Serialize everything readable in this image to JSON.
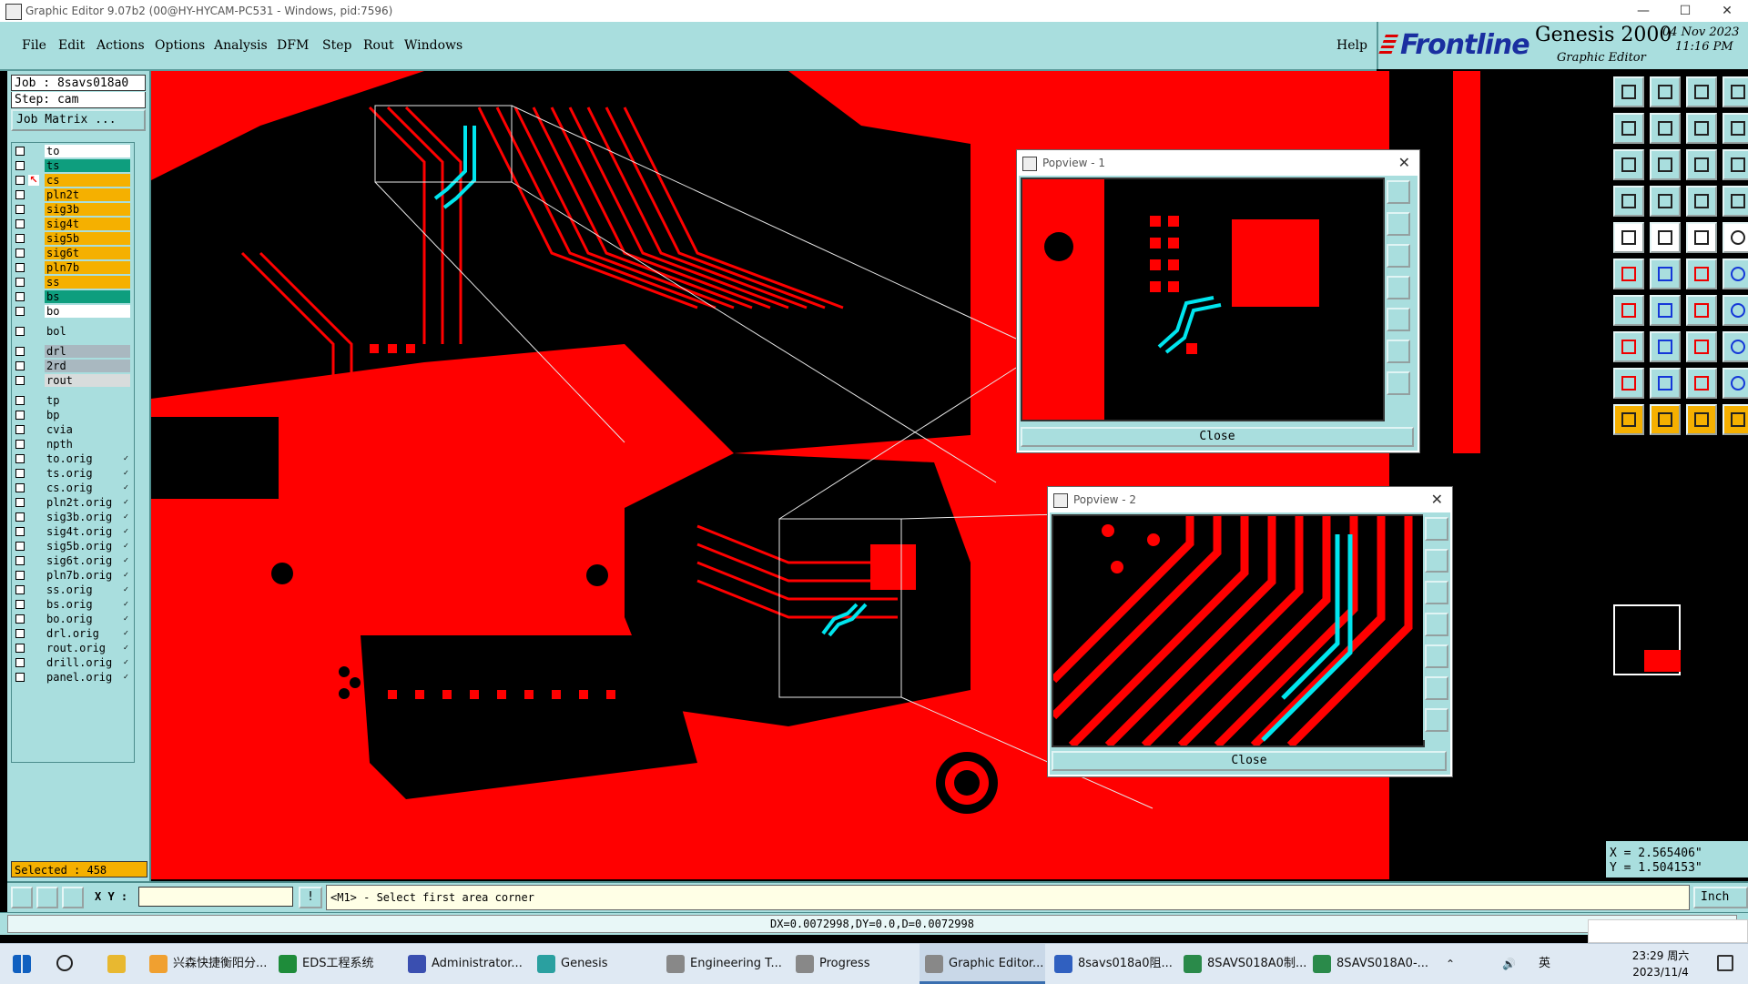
{
  "window": {
    "title": "Graphic Editor 9.07b2 (00@HY-HYCAM-PC531 - Windows, pid:7596)"
  },
  "menu": [
    "File",
    "Edit",
    "Actions",
    "Options",
    "Analysis",
    "DFM",
    "Step",
    "Rout",
    "Windows"
  ],
  "help": "Help",
  "brand": {
    "logo": "Frontline",
    "product": "Genesis 2000",
    "subtitle": "Graphic Editor",
    "date": "04 Nov 2023",
    "time": "11:16 PM"
  },
  "job": {
    "job_line": "Job : 8savs018a0",
    "step_line": "Step: cam",
    "matrix_button": "Job Matrix ..."
  },
  "layers": [
    {
      "name": "to",
      "color": "#ffffff"
    },
    {
      "name": "ts",
      "color": "#0e9e7e"
    },
    {
      "name": "cs",
      "color": "#f5b000"
    },
    {
      "name": "pln2t",
      "color": "#f5b000"
    },
    {
      "name": "sig3b",
      "color": "#f5b000"
    },
    {
      "name": "sig4t",
      "color": "#f5b000"
    },
    {
      "name": "sig5b",
      "color": "#f5b000"
    },
    {
      "name": "sig6t",
      "color": "#f5b000"
    },
    {
      "name": "pln7b",
      "color": "#f5b000"
    },
    {
      "name": "ss",
      "color": "#f5b000"
    },
    {
      "name": "bs",
      "color": "#0e9e7e"
    },
    {
      "name": "bo",
      "color": "#ffffff"
    },
    {
      "name": "bol",
      "color": "#a9dede"
    },
    {
      "name": "drl",
      "color": "#a9b8c0"
    },
    {
      "name": "2rd",
      "color": "#a9b8c0"
    },
    {
      "name": "rout",
      "color": "#d8dcdc"
    },
    {
      "name": "tp",
      "color": "#a9dede"
    },
    {
      "name": "bp",
      "color": "#a9dede"
    },
    {
      "name": "cvia",
      "color": "#a9dede"
    },
    {
      "name": "npth",
      "color": "#a9dede"
    },
    {
      "name": "to.orig",
      "color": "#a9dede"
    },
    {
      "name": "ts.orig",
      "color": "#a9dede"
    },
    {
      "name": "cs.orig",
      "color": "#a9dede"
    },
    {
      "name": "pln2t.orig",
      "color": "#a9dede"
    },
    {
      "name": "sig3b.orig",
      "color": "#a9dede"
    },
    {
      "name": "sig4t.orig",
      "color": "#a9dede"
    },
    {
      "name": "sig5b.orig",
      "color": "#a9dede"
    },
    {
      "name": "sig6t.orig",
      "color": "#a9dede"
    },
    {
      "name": "pln7b.orig",
      "color": "#a9dede"
    },
    {
      "name": "ss.orig",
      "color": "#a9dede"
    },
    {
      "name": "bs.orig",
      "color": "#a9dede"
    },
    {
      "name": "bo.orig",
      "color": "#a9dede"
    },
    {
      "name": "drl.orig",
      "color": "#a9dede"
    },
    {
      "name": "rout.orig",
      "color": "#a9dede"
    },
    {
      "name": "drill.orig",
      "color": "#a9dede"
    },
    {
      "name": "panel.orig",
      "color": "#a9dede"
    }
  ],
  "selected": "Selected : 458",
  "popview1": {
    "title": "Popview - 1",
    "close": "Close"
  },
  "popview2": {
    "title": "Popview - 2",
    "close": "Close"
  },
  "coords": {
    "x": "X = 2.565406\"",
    "y": "Y = 1.504153\""
  },
  "command": {
    "xy_label": "X Y :",
    "xy_value": "",
    "bang": "!",
    "prompt": "<M1> - Select first area corner",
    "unit": "Inch"
  },
  "status": "DX=0.0072998,DY=0.0,D=0.0072998",
  "colors": {
    "copper": "#ff0000",
    "highlight": "#00e5ee",
    "panel": "#a9dede",
    "selected_layer": "#f5b000"
  },
  "taskbar": {
    "items": [
      {
        "label": "兴森快捷衡阳分...",
        "color": "#f0a030"
      },
      {
        "label": "EDS工程系统",
        "color": "#1e8c3a"
      },
      {
        "label": "Administrator...",
        "color": "#3a4fb0"
      },
      {
        "label": "Genesis",
        "color": "#2aa0a0"
      },
      {
        "label": "Engineering T...",
        "color": "#888888"
      },
      {
        "label": "Progress",
        "color": "#888888"
      },
      {
        "label": "Graphic Editor...",
        "color": "#888888"
      },
      {
        "label": "8savs018a0阻...",
        "color": "#3060c0"
      },
      {
        "label": "8SAVS018A0制...",
        "color": "#2a8a4a"
      },
      {
        "label": "8SAVS018A0-...",
        "color": "#2a8a4a"
      }
    ],
    "ime": "英",
    "clock_time": "23:29 周六",
    "clock_date": "2023/11/4"
  }
}
